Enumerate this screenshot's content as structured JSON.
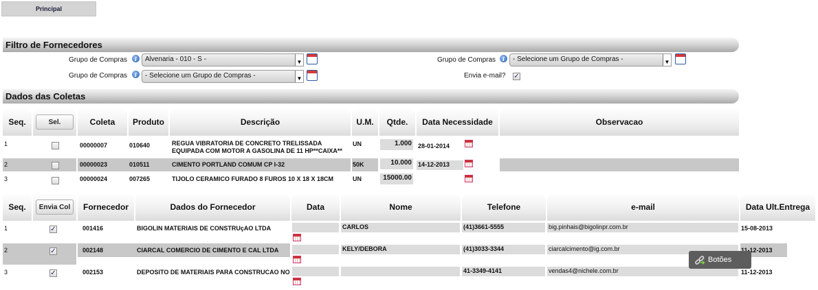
{
  "tabs": {
    "principal": "Principal"
  },
  "filtro": {
    "title": "Filtro de Fornecedores",
    "grupo_label": "Grupo de Compras",
    "grupo1_value": "Alvenaria - 010 - S -",
    "grupo2_value": "- Selecione um Grupo de Compras -",
    "grupo3_value": "- Selecione um Grupo de Compras -",
    "envia_label": "Envia e-mail?",
    "envia_checked": true
  },
  "coletas": {
    "title": "Dados das Coletas",
    "headers": {
      "seq": "Seq.",
      "sel": "Sel.",
      "coleta": "Coleta",
      "produto": "Produto",
      "descricao": "Descrição",
      "um": "U.M.",
      "qtde": "Qtde.",
      "data_necessidade": "Data Necessidade",
      "observacao": "Observacao"
    },
    "rows": [
      {
        "seq": "1",
        "coleta": "00000007",
        "produto": "010640",
        "descricao1": "REGUA VIBRATORIA DE CONCRETO TRELISSADA",
        "descricao2": "EQUIPADA COM MOTOR A GASOLINA DE 11 HP**CAIXA**",
        "um": "UN",
        "qtde": "1.000",
        "data": "28-01-2014"
      },
      {
        "seq": "2",
        "coleta": "00000023",
        "produto": "010511",
        "descricao1": "CIMENTO PORTLAND COMUM CP I-32",
        "descricao2": "",
        "um": "50K",
        "qtde": "10.000",
        "data": "14-12-2013"
      },
      {
        "seq": "3",
        "coleta": "00000024",
        "produto": "007265",
        "descricao1": "TIJOLO CERAMICO FURADO 8 FUROS 10 X 18 X 18CM",
        "descricao2": "",
        "um": "UN",
        "qtde": "15000.00",
        "data": ""
      }
    ]
  },
  "fornecedores": {
    "headers": {
      "seq": "Seq.",
      "envia": "Envia Col",
      "fornecedor": "Fornecedor",
      "dados": "Dados do Fornecedor",
      "data": "Data",
      "nome": "Nome",
      "telefone": "Telefone",
      "email": "e-mail",
      "data_ult": "Data Ult.Entrega"
    },
    "rows": [
      {
        "seq": "1",
        "codigo": "001416",
        "dados": "BIGOLIN MATERIAIS DE CONSTRUçAO LTDA",
        "nome": "CARLOS",
        "telefone": "(41)3661-5555",
        "email": "big.pinhais@bigolinpr.com.br",
        "data_ult": "15-08-2013"
      },
      {
        "seq": "2",
        "codigo": "002148",
        "dados": "CIARCAL COMERCIO DE CIMENTO E CAL LTDA",
        "nome": "KELY/DEBORA",
        "telefone": "(41)3033-3344",
        "email": "ciarcalcimento@ig.com.br",
        "data_ult": "11-12-2013"
      },
      {
        "seq": "3",
        "codigo": "002153",
        "dados": "DEPOSITO DE MATERIAIS PARA CONSTRUCAO NO",
        "nome": "",
        "telefone": "41-3349-4141",
        "email": "vendas4@nichele.com.br",
        "data_ult": "11-12-2013"
      }
    ]
  },
  "botoes": {
    "label": "Botões"
  },
  "colors": {
    "section_bar": "#a9a9a9",
    "row_highlight": "#c8c8c8",
    "field_bg": "#dcdcdc"
  }
}
